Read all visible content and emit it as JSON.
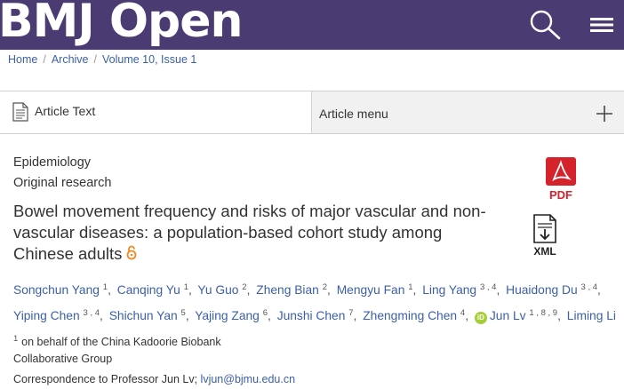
{
  "header": {
    "logo_text": "BMJ Open",
    "bg_color": "#4a3b73",
    "search_icon": "search-icon",
    "menu_icon": "hamburger-menu-icon"
  },
  "breadcrumb": [
    "Home",
    "Archive",
    "Volume 10, Issue 1"
  ],
  "tabs": {
    "article_text": "Article Text",
    "article_menu": "Article menu"
  },
  "article": {
    "subject": "Epidemiology",
    "type": "Original research",
    "title": "Bowel movement frequency and risks of major vascular and non-vascular diseases: a population-based cohort study among Chinese adults",
    "pdf_label": "PDF",
    "xml_label": "XML",
    "authors": [
      {
        "name": "Songchun Yang",
        "sup": "1"
      },
      {
        "name": "Canqing Yu",
        "sup": "1"
      },
      {
        "name": "Yu Guo",
        "sup": "2"
      },
      {
        "name": "Zheng Bian",
        "sup": "2"
      },
      {
        "name": "Mengyu Fan",
        "sup": "1"
      },
      {
        "name": "Ling Yang",
        "sup": "3 , 4"
      },
      {
        "name": "Huaidong Du",
        "sup": "3 , 4"
      },
      {
        "name": "Yiping Chen",
        "sup": "3 , 4"
      },
      {
        "name": "Shichun Yan",
        "sup": "5"
      },
      {
        "name": "Yajing Zang",
        "sup": "6"
      },
      {
        "name": "Junshi Chen",
        "sup": "7"
      },
      {
        "name": "Zhengming Chen",
        "sup": "4"
      },
      {
        "name": "Jun Lv",
        "sup": "1 , 8 , 9"
      },
      {
        "name": "Liming Li",
        "sup": "1"
      }
    ],
    "on_behalf": "on behalf of the China Kadoorie Biobank",
    "collab_group": "Collaborative Group",
    "correspondence_prefix": "Correspondence to Professor Jun Lv;",
    "correspondence_email": "lvjun@bjmu.edu.cn"
  }
}
